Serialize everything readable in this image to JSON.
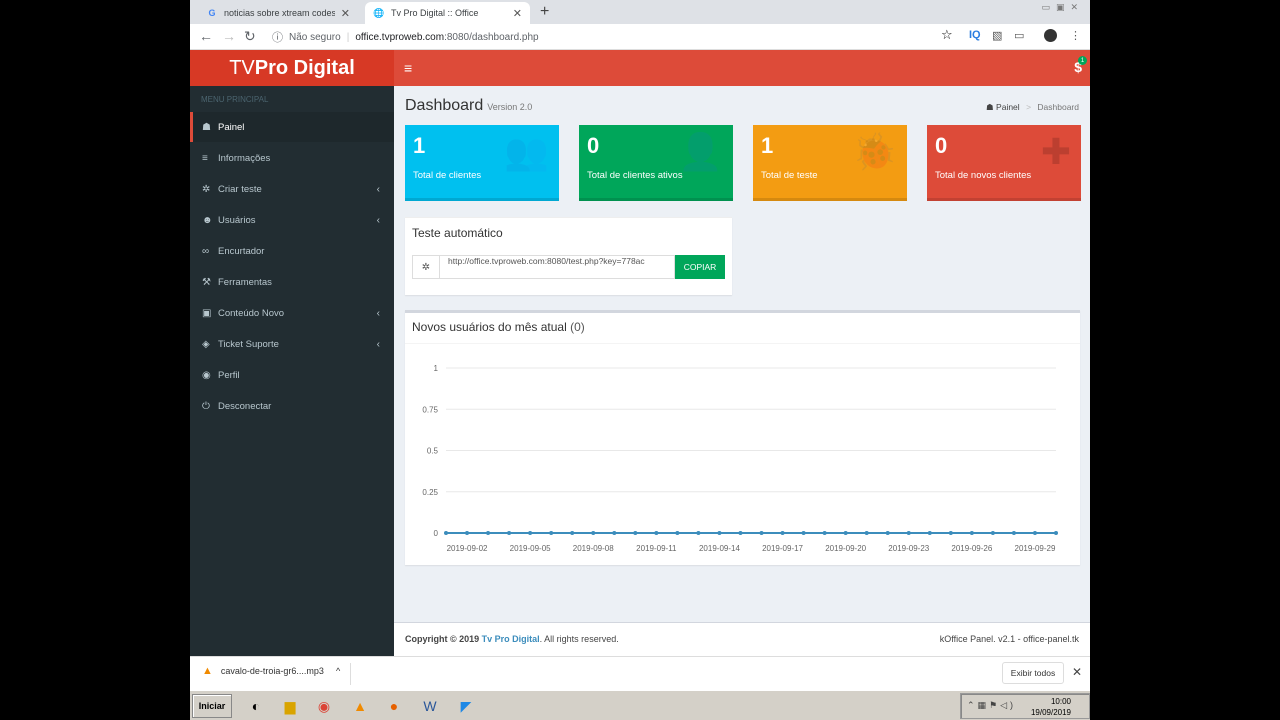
{
  "browser": {
    "tabs": [
      {
        "title": "noticias sobre xtream codes iptv - Pe",
        "favicon": "G"
      },
      {
        "title": "Tv Pro Digital :: Office",
        "favicon": "globe"
      }
    ],
    "address": {
      "security": "Não seguro",
      "host": "office.tvproweb.com",
      "path": ":8080/dashboard.php"
    }
  },
  "app": {
    "logo_light": "TV ",
    "logo_bold": "Pro Digital",
    "notif_badge": "1",
    "notif_symbol": "$"
  },
  "sidebar": {
    "header": "MENU PRINCIPAL",
    "items": [
      {
        "label": "Painel",
        "icon": "dashboard-icon",
        "glyph": "☗",
        "active": true,
        "has_submenu": false
      },
      {
        "label": "Informações",
        "icon": "list-icon",
        "glyph": "≡",
        "active": false,
        "has_submenu": false
      },
      {
        "label": "Criar teste",
        "icon": "bug-icon",
        "glyph": "✲",
        "active": false,
        "has_submenu": true
      },
      {
        "label": "Usuários",
        "icon": "users-icon",
        "glyph": "☻",
        "active": false,
        "has_submenu": true
      },
      {
        "label": "Encurtador",
        "icon": "link-icon",
        "glyph": "∞",
        "active": false,
        "has_submenu": false
      },
      {
        "label": "Ferramentas",
        "icon": "wrench-icon",
        "glyph": "⚒",
        "active": false,
        "has_submenu": false
      },
      {
        "label": "Conteúdo Novo",
        "icon": "film-icon",
        "glyph": "▣",
        "active": false,
        "has_submenu": true
      },
      {
        "label": "Ticket Suporte",
        "icon": "ticket-icon",
        "glyph": "◈",
        "active": false,
        "has_submenu": true
      },
      {
        "label": "Perfil",
        "icon": "user-circle-icon",
        "glyph": "◉",
        "active": false,
        "has_submenu": false
      },
      {
        "label": "Desconectar",
        "icon": "power-icon",
        "glyph": "⏻",
        "active": false,
        "has_submenu": false
      }
    ]
  },
  "page": {
    "title": "Dashboard",
    "version": "Version 2.0",
    "breadcrumb_home": "Painel",
    "breadcrumb_current": "Dashboard"
  },
  "stats": [
    {
      "value": "1",
      "label": "Total de clientes",
      "icon": "users-icon",
      "glyph": "👥"
    },
    {
      "value": "0",
      "label": "Total de clientes ativos",
      "icon": "user-icon",
      "glyph": "👤"
    },
    {
      "value": "1",
      "label": "Total de teste",
      "icon": "bug-icon",
      "glyph": "🐞"
    },
    {
      "value": "0",
      "label": "Total de novos clientes",
      "icon": "plus-circle-icon",
      "glyph": "✚"
    }
  ],
  "autotest": {
    "title": "Teste automático",
    "url": "http://office.tvproweb.com:8080/test.php?key=778ac",
    "button": "COPIAR"
  },
  "chart_title": "Novos usuários do mês atual",
  "chart_count": "(0)",
  "chart_data": {
    "type": "line",
    "title": "Novos usuários do mês atual (0)",
    "xlabel": "",
    "ylabel": "",
    "ylim": [
      0,
      1
    ],
    "yticks": [
      "0",
      "0.25",
      "0.5",
      "0.75",
      "1"
    ],
    "x_tick_labels": [
      "2019-09-02",
      "2019-09-05",
      "2019-09-08",
      "2019-09-11",
      "2019-09-14",
      "2019-09-17",
      "2019-09-20",
      "2019-09-23",
      "2019-09-26",
      "2019-09-29"
    ],
    "x": [
      "2019-09-01",
      "2019-09-02",
      "2019-09-03",
      "2019-09-04",
      "2019-09-05",
      "2019-09-06",
      "2019-09-07",
      "2019-09-08",
      "2019-09-09",
      "2019-09-10",
      "2019-09-11",
      "2019-09-12",
      "2019-09-13",
      "2019-09-14",
      "2019-09-15",
      "2019-09-16",
      "2019-09-17",
      "2019-09-18",
      "2019-09-19",
      "2019-09-20",
      "2019-09-21",
      "2019-09-22",
      "2019-09-23",
      "2019-09-24",
      "2019-09-25",
      "2019-09-26",
      "2019-09-27",
      "2019-09-28",
      "2019-09-29",
      "2019-09-30"
    ],
    "series": [
      {
        "values": [
          0,
          0,
          0,
          0,
          0,
          0,
          0,
          0,
          0,
          0,
          0,
          0,
          0,
          0,
          0,
          0,
          0,
          0,
          0,
          0,
          0,
          0,
          0,
          0,
          0,
          0,
          0,
          0,
          0,
          0
        ]
      }
    ],
    "grid": true,
    "color": "#3c8dbc"
  },
  "footer": {
    "copyright_prefix": "Copyright © 2019 ",
    "brand": "Tv Pro Digital",
    "suffix": ". All rights reserved.",
    "right": "kOffice Panel. v2.1 - office-panel.tk"
  },
  "downloads": {
    "file": "cavalo-de-troia-gr6....mp3",
    "show_all": "Exibir todos"
  },
  "taskbar": {
    "start": "Iniciar",
    "time": "10:00",
    "date": "19/09/2019"
  }
}
